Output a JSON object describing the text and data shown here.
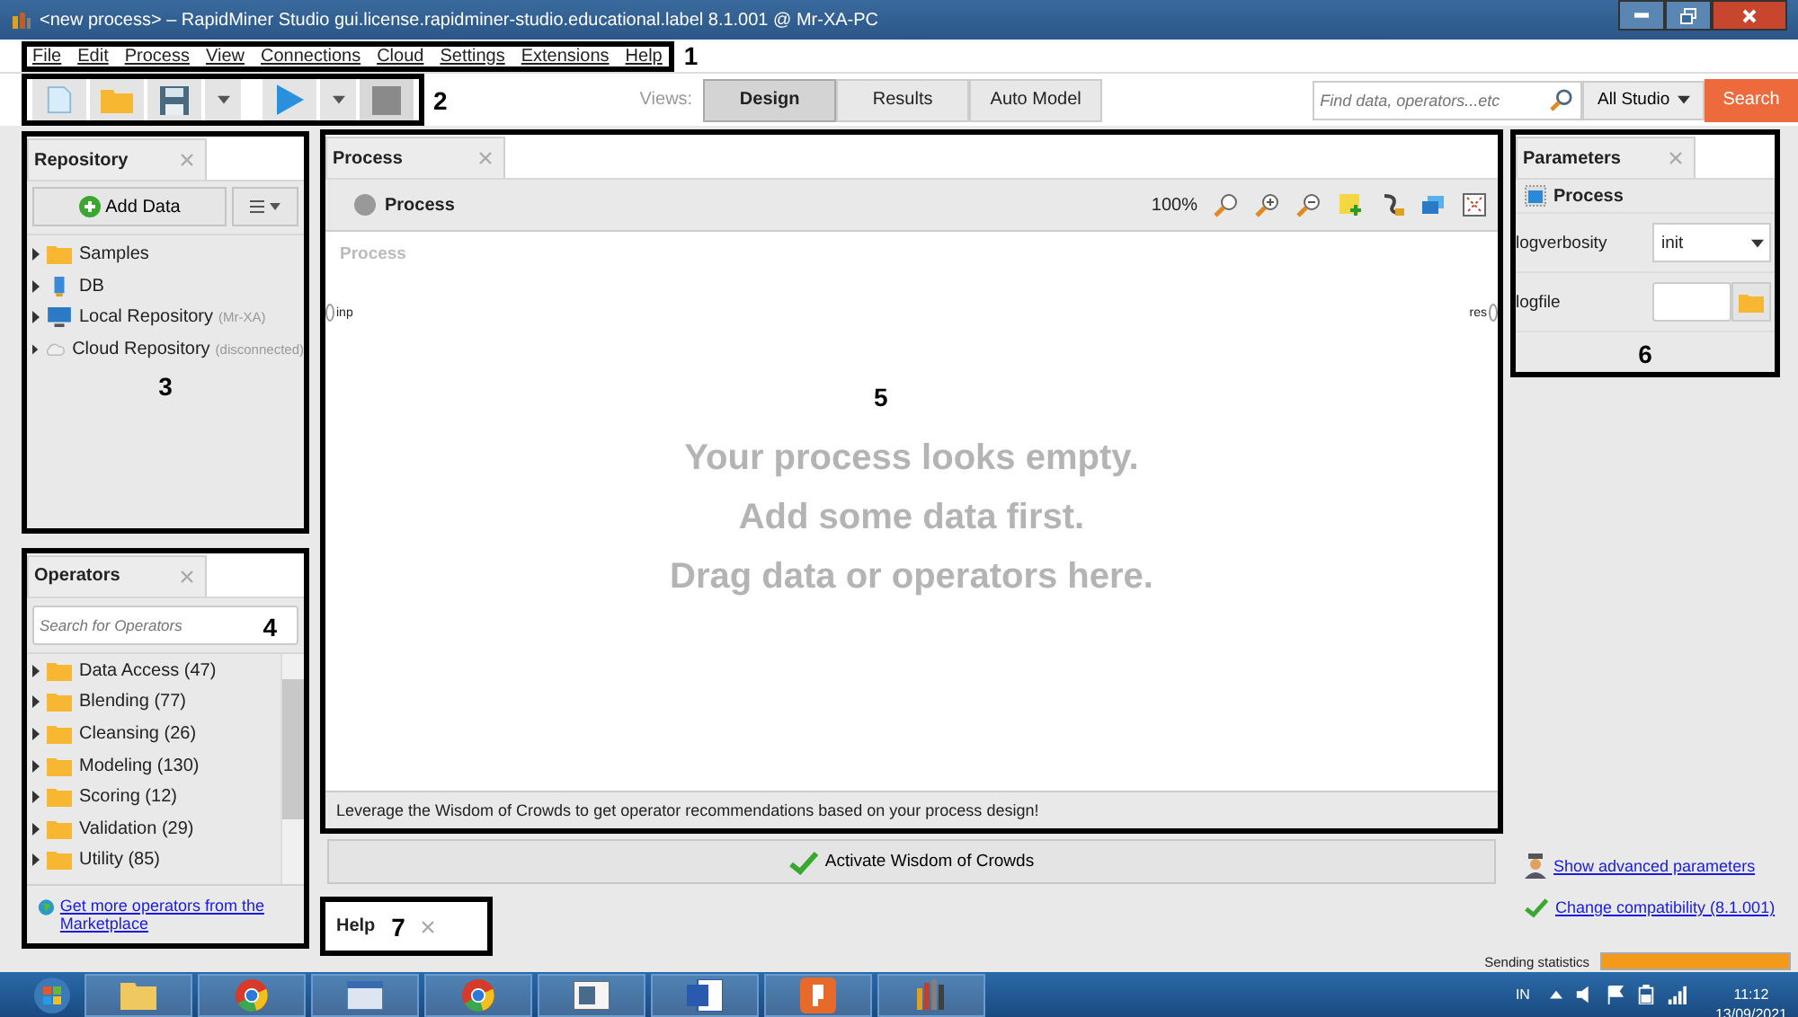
{
  "window": {
    "title": "<new process> – RapidMiner Studio gui.license.rapidminer-studio.educational.label 8.1.001 @ Mr-XA-PC"
  },
  "menu": {
    "callout": "1",
    "items": [
      "File",
      "Edit",
      "Process",
      "View",
      "Connections",
      "Cloud",
      "Settings",
      "Extensions",
      "Help"
    ]
  },
  "toolbar": {
    "callout": "2"
  },
  "views": {
    "label": "Views:",
    "buttons": [
      {
        "label": "Design",
        "selected": true
      },
      {
        "label": "Results",
        "selected": false
      },
      {
        "label": "Auto Model",
        "selected": false
      }
    ]
  },
  "search": {
    "placeholder": "Find data, operators...etc",
    "scope": "All Studio",
    "button": "Search"
  },
  "repository": {
    "title": "Repository",
    "callout": "3",
    "add_button": "Add Data",
    "items": [
      {
        "kind": "folder",
        "name": "Samples"
      },
      {
        "kind": "database",
        "name": "DB"
      },
      {
        "kind": "computer",
        "name": "Local Repository",
        "note": "(Mr-XA)"
      },
      {
        "kind": "cloud",
        "name": "Cloud Repository",
        "note": "(disconnected)"
      }
    ]
  },
  "operators": {
    "title": "Operators",
    "callout": "4",
    "search_placeholder": "Search for Operators",
    "items": [
      "Data Access (47)",
      "Blending (77)",
      "Cleansing (26)",
      "Modeling (130)",
      "Scoring (12)",
      "Validation (29)",
      "Utility (85)"
    ],
    "link": "Get more operators from the Marketplace"
  },
  "process": {
    "tab": "Process",
    "callout": "5",
    "breadcrumb": "Process",
    "zoom": "100%",
    "canvas_label": "Process",
    "input_port": "inp",
    "output_port": "res",
    "empty_message": [
      "Your process looks empty.",
      "Add some data first.",
      "Drag data or operators here."
    ],
    "hint": "Leverage the Wisdom of Crowds to get operator recommendations based on your process design!",
    "activate_button": "Activate Wisdom of Crowds"
  },
  "parameters": {
    "title": "Parameters",
    "callout": "6",
    "operator": "Process",
    "rows": [
      {
        "kind": "select",
        "name": "logverbosity",
        "value": "init"
      },
      {
        "kind": "file",
        "name": "logfile"
      }
    ],
    "links": [
      "Show advanced parameters",
      "Change compatibility (8.1.001)"
    ]
  },
  "help": {
    "title": "Help",
    "callout": "7"
  },
  "status": {
    "text": "Sending statistics",
    "level": 1
  },
  "taskbar": {
    "language": "IN",
    "time": "11:12",
    "date": "13/09/2021"
  }
}
